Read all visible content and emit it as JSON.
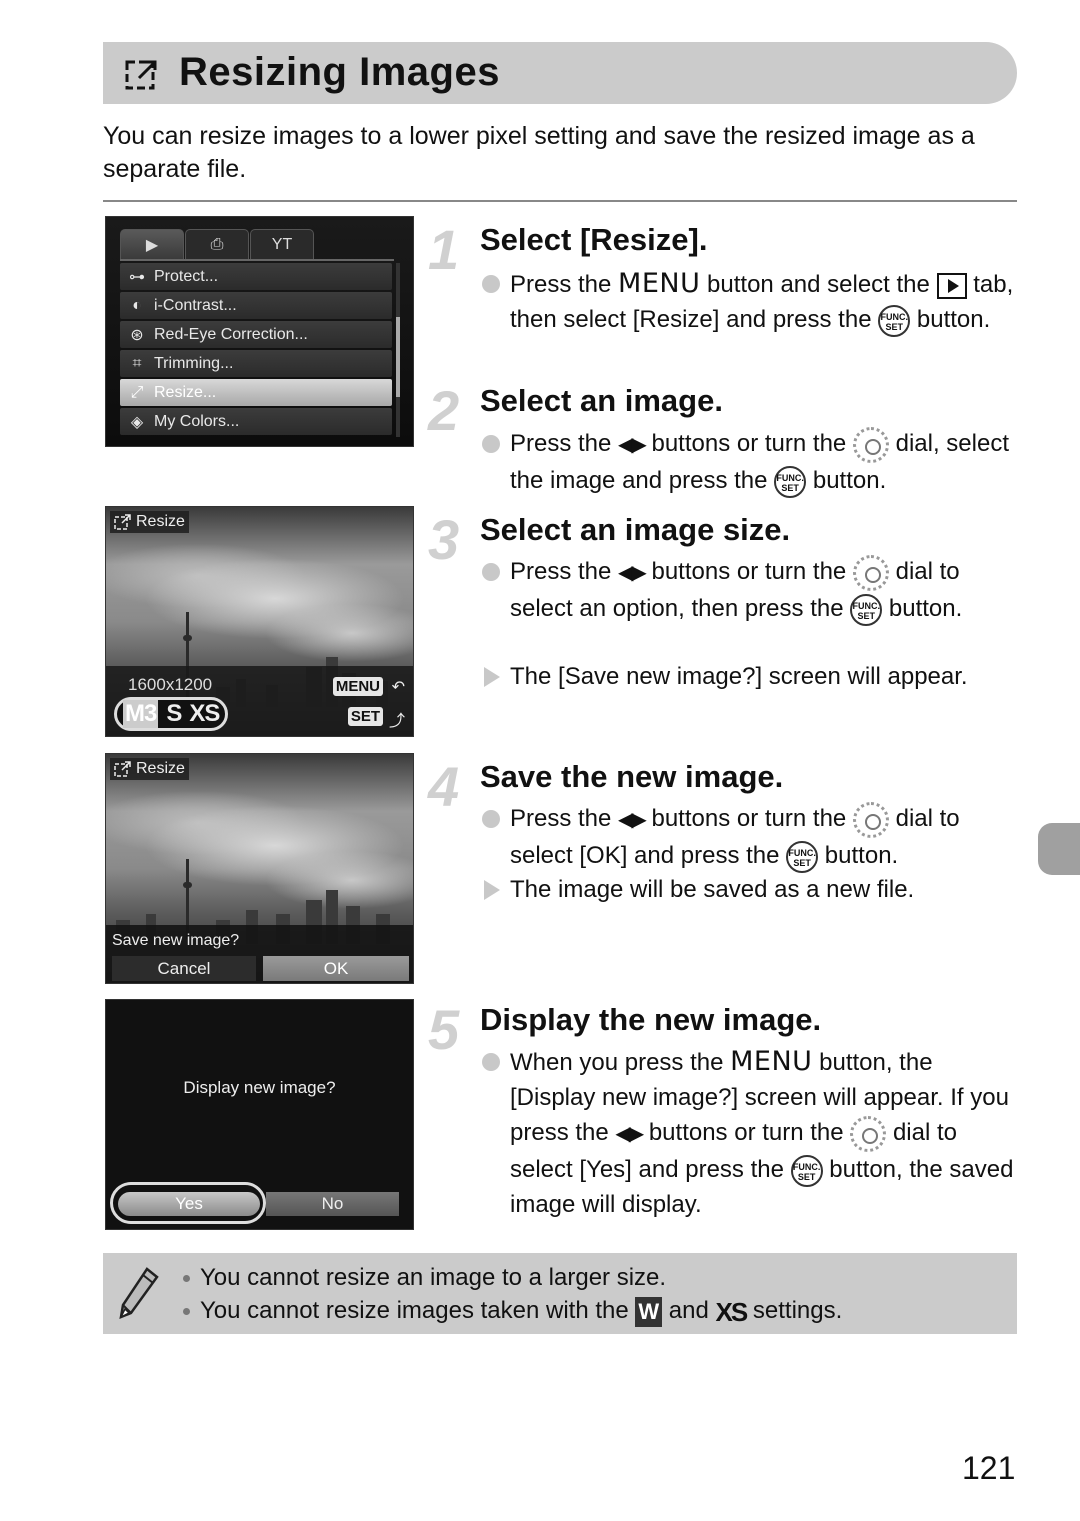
{
  "title": {
    "icon": "resize-icon",
    "text": "Resizing Images"
  },
  "intro": "You can resize images to a lower pixel setting and save the resized image as a separate file.",
  "screens": {
    "menu": {
      "tabs": [
        {
          "icon": "playback-tab-icon",
          "glyph": "▶",
          "active": true
        },
        {
          "icon": "print-tab-icon",
          "glyph": "⎙",
          "active": false
        },
        {
          "icon": "settings-tab-icon",
          "glyph": "ΥΤ",
          "active": false
        }
      ],
      "items": [
        {
          "icon": "protect-key-icon",
          "glyph": "⊶",
          "label": "Protect..."
        },
        {
          "icon": "i-contrast-icon",
          "glyph": "◐",
          "label": "i-Contrast..."
        },
        {
          "icon": "red-eye-icon",
          "glyph": "⊛",
          "label": "Red-Eye Correction..."
        },
        {
          "icon": "trimming-icon",
          "glyph": "⌗",
          "label": "Trimming..."
        },
        {
          "icon": "resize-icon",
          "glyph": "⤢",
          "label": "Resize...",
          "selected": true
        },
        {
          "icon": "my-colors-icon",
          "glyph": "◈",
          "label": "My Colors..."
        }
      ]
    },
    "size_select": {
      "label": "Resize",
      "pixel_readout": "1600x1200",
      "sizes": [
        "M3",
        "S",
        "XS"
      ],
      "selected_size": "M3",
      "menu_key": "MENU",
      "menu_key_icon": "↶",
      "set_key": "SET",
      "set_key_icon": "⤴"
    },
    "save_confirm": {
      "label": "Resize",
      "prompt": "Save new image?",
      "cancel": "Cancel",
      "ok": "OK",
      "selected": "OK"
    },
    "display_confirm": {
      "prompt": "Display new image?",
      "yes": "Yes",
      "no": "No",
      "selected": "Yes"
    }
  },
  "steps": [
    {
      "number": "1",
      "heading": "Select [Resize].",
      "bullets": [
        {
          "type": "action",
          "parts": [
            "Press the ",
            "MENU",
            " button and select the ",
            "[play]",
            " tab, then select [Resize] and press the ",
            "[func]",
            " button."
          ]
        }
      ]
    },
    {
      "number": "2",
      "heading": "Select an image.",
      "bullets": [
        {
          "type": "action",
          "parts": [
            "Press the ",
            "◀▶",
            " buttons or turn the ",
            "[dial]",
            " dial, select the image and press the ",
            "[func]",
            " button."
          ]
        }
      ]
    },
    {
      "number": "3",
      "heading": "Select an image size.",
      "bullets": [
        {
          "type": "action",
          "parts": [
            "Press the ",
            "◀▶",
            " buttons or turn the ",
            "[dial]",
            " dial to select an option, then press the ",
            "[func]",
            " button."
          ]
        },
        {
          "type": "result",
          "text": "The [Save new image?] screen will appear."
        }
      ]
    },
    {
      "number": "4",
      "heading": "Save the new image.",
      "bullets": [
        {
          "type": "action",
          "parts": [
            "Press the ",
            "◀▶",
            " buttons or turn the ",
            "[dial]",
            " dial to select [OK] and press the ",
            "[func]",
            " button."
          ]
        },
        {
          "type": "result",
          "text": "The image will be saved as a new file."
        }
      ]
    },
    {
      "number": "5",
      "heading": "Display the new image.",
      "bullets": [
        {
          "type": "action",
          "parts": [
            "When you press the ",
            "MENU",
            " button, the [Display new image?] screen will appear. If you press the ",
            "◀▶",
            " buttons or turn the ",
            "[dial]",
            " dial to select [Yes] and press the ",
            "[func]",
            " button, the saved image will display."
          ]
        }
      ]
    }
  ],
  "icons": {
    "func_top": "FUNC.",
    "func_bottom": "SET",
    "menu_word": "MENU",
    "arrows": "◀▶"
  },
  "notes": {
    "icon": "pencil-icon",
    "line1": "You cannot resize an image to a larger size.",
    "line2_pre": "You cannot resize images taken with the ",
    "mode_w": "W",
    "line2_mid": " and ",
    "mode_xs": "XS",
    "line2_post": " settings."
  },
  "page_number": "121"
}
